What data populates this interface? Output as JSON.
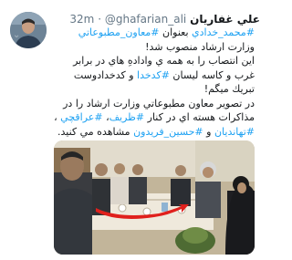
{
  "tweet": {
    "display_name": "علي غفاريان",
    "handle": "@ghafarian_ali",
    "separator": "·",
    "timestamp": "32m",
    "lines": [
      [
        {
          "t": "#محمد_خدادي",
          "h": true
        },
        {
          "t": " بعنوان ",
          "h": false
        },
        {
          "t": "#معاون_مطبوعاتي",
          "h": true
        }
      ],
      [
        {
          "t": "وزارت ارشاد منصوب شد!",
          "h": false
        }
      ],
      [
        {
          "t": "اين انتصاب را به همه ي وادادهِ هاي در برابر",
          "h": false
        }
      ],
      [
        {
          "t": "غرب و كاسه ليسان ",
          "h": false
        },
        {
          "t": "#كدخدا",
          "h": true
        },
        {
          "t": " و كدخدادوست",
          "h": false
        }
      ],
      [
        {
          "t": "تبريك ميگم!",
          "h": false
        }
      ],
      [
        {
          "t": "در تصوير معاون مطبوعاتي وزارت ارشاد را در",
          "h": false
        }
      ],
      [
        {
          "t": "مذاكرات هسته اي در كنار ",
          "h": false
        },
        {
          "t": "#ظريف",
          "h": true
        },
        {
          "t": "، ",
          "h": false
        },
        {
          "t": "#عراقچي",
          "h": true
        },
        {
          "t": " ،",
          "h": false
        }
      ],
      [
        {
          "t": "#تهانديان",
          "h": true
        },
        {
          "t": " و ",
          "h": false
        },
        {
          "t": "#حسين_فريدون",
          "h": true
        },
        {
          "t": " مشاهده مي كنيد.",
          "h": false
        }
      ]
    ]
  }
}
